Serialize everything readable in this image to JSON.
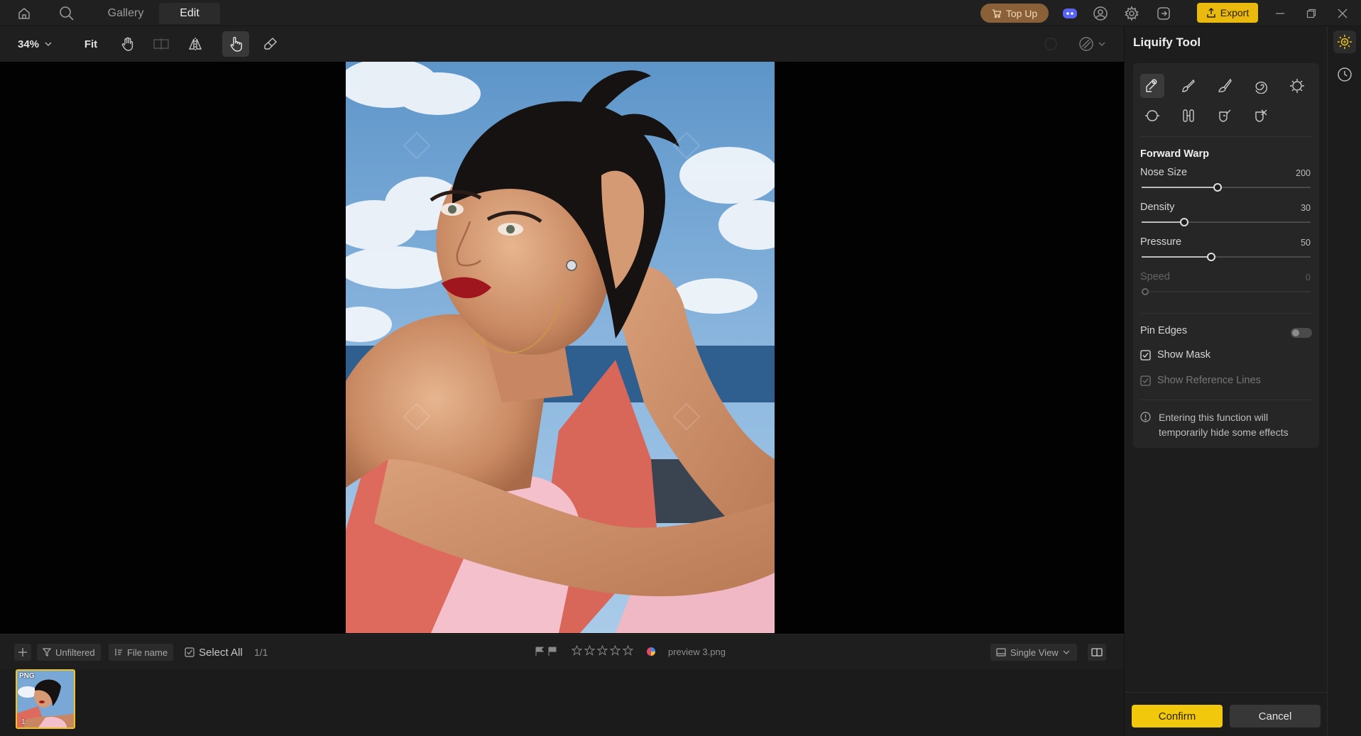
{
  "titlebar": {
    "tabs": [
      {
        "label": "Gallery"
      },
      {
        "label": "Edit"
      }
    ],
    "top_up_label": "Top Up",
    "export_label": "Export",
    "colors": {
      "topup": "#8a6039",
      "export": "#e9b90e"
    }
  },
  "toolbar": {
    "zoom": "34%",
    "fit_label": "Fit",
    "tools": [
      "hand-icon",
      "compare-icon",
      "flip-icon",
      "liquify-hand-icon",
      "eraser-icon"
    ],
    "active_tool": "liquify-hand-icon"
  },
  "bottom_bar": {
    "filter_label": "Unfiltered",
    "sort_label": "File name",
    "select_all_label": "Select All",
    "count": "1/1",
    "file_name": "preview 3.png",
    "view_label": "Single View",
    "rating_stars": 5
  },
  "thumbnail": {
    "badge": "PNG",
    "index": "1"
  },
  "panel": {
    "title": "Liquify Tool",
    "mode_title": "Forward Warp",
    "sliders": [
      {
        "label": "Nose Size",
        "value": "200",
        "fraction": 0.45
      },
      {
        "label": "Density",
        "value": "30",
        "fraction": 0.25
      },
      {
        "label": "Pressure",
        "value": "50",
        "fraction": 0.41
      },
      {
        "label": "Speed",
        "value": "0",
        "fraction": 0.0
      }
    ],
    "pin_edges_label": "Pin Edges",
    "pin_edges_on": false,
    "show_mask_label": "Show Mask",
    "show_mask_checked": true,
    "show_reference_lines_label": "Show Reference Lines",
    "show_reference_lines_checked": true,
    "info_text_line1": "Entering this function will",
    "info_text_line2": "temporarily hide some effects",
    "confirm_label": "Confirm",
    "cancel_label": "Cancel",
    "accent": "#f2c80c"
  }
}
